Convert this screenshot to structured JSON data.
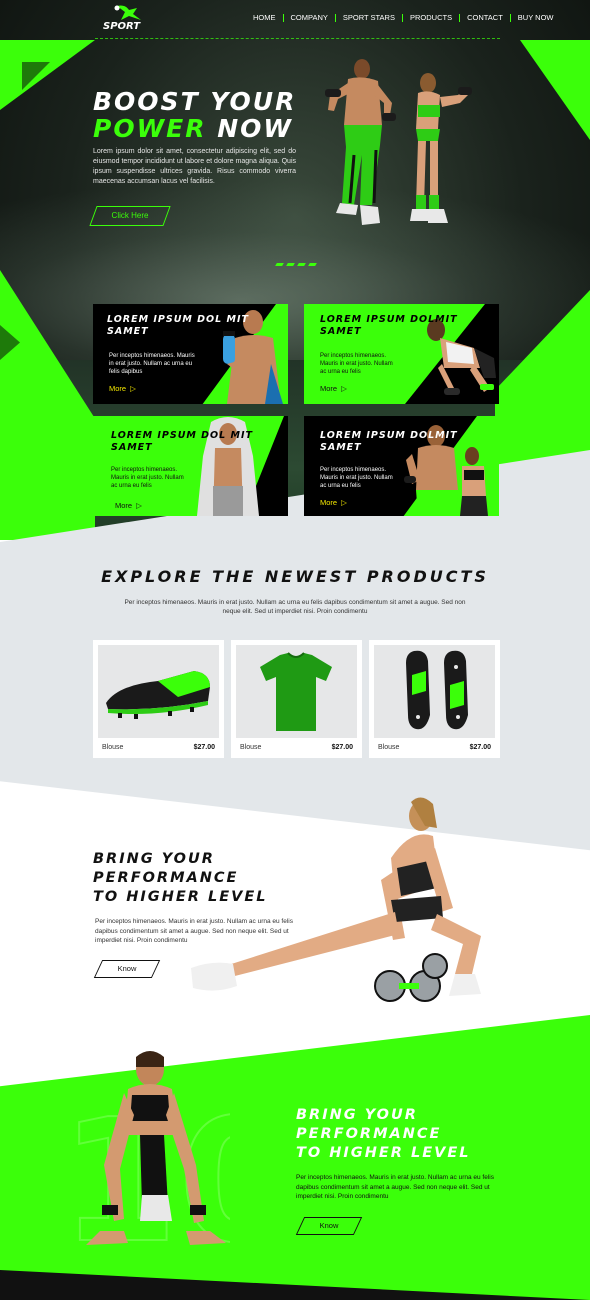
{
  "brand": {
    "logo_text": "SPORT"
  },
  "nav": {
    "items": [
      "HOME",
      "COMPANY",
      "SPORT STARS",
      "PRODUCTS",
      "CONTACT",
      "BUY NOW"
    ]
  },
  "hero": {
    "title_line1": "BOOST YOUR",
    "title_accent": "POWER",
    "title_rest": "NOW",
    "text": "Lorem ipsum dolor sit amet, consectetur adipiscing elit, sed do eiusmod tempor incididunt ut labore et dolore magna aliqua. Quis ipsum suspendisse ultrices gravida. Risus commodo viverra maecenas accumsan lacus vel facilisis.",
    "button": "Click Here"
  },
  "banners": [
    {
      "title": "LOREM IPSUM DOL MIT SAMET",
      "text": "Per inceptos himenaeos. Mauris in erat justo. Nullam ac urna eu felis dapibus",
      "more": "More"
    },
    {
      "title": "LOREM IPSUM DOLMIT SAMET",
      "text": "Per inceptos himenaeos. Mauris in erat justo. Nullam ac urna eu felis",
      "more": "More"
    },
    {
      "title": "LOREM IPSUM DOL MIT SAMET",
      "text": "Per inceptos himenaeos. Mauris in erat justo. Nullam ac urna eu felis",
      "more": "More"
    },
    {
      "title": "LOREM IPSUM DOLMIT SAMET",
      "text": "Per inceptos himenaeos. Mauris in erat justo. Nullam ac urna eu felis",
      "more": "More"
    }
  ],
  "products": {
    "title": "EXPLORE THE NEWEST PRODUCTS",
    "subtitle": "Per inceptos himenaeos. Mauris in erat justo. Nullam ac urna eu felis dapibus condimentum sit amet a augue. Sed non neque elit. Sed ut imperdiet nisi. Proin condimentu",
    "items": [
      {
        "name": "Blouse",
        "price": "$27.00"
      },
      {
        "name": "Blouse",
        "price": "$27.00"
      },
      {
        "name": "Blouse",
        "price": "$27.00"
      }
    ]
  },
  "performance1": {
    "title_lines": [
      "BRING YOUR",
      "PERFORMANCE",
      "TO HIGHER LEVEL"
    ],
    "text": "Per inceptos himenaeos. Mauris in erat justo. Nullam ac urna eu felis dapibus condimentum sit amet a augue. Sed non neque elit. Sed ut imperdiet nisi. Proin condimentu",
    "button": "Know"
  },
  "performance2": {
    "title_lines": [
      "BRING YOUR",
      "PERFORMANCE",
      "TO HIGHER LEVEL"
    ],
    "text": "Per inceptos himenaeos. Mauris in erat justo. Nullam ac urna eu felis dapibus condimentum sit amet a augue. Sed non neque elit. Sed ut imperdiet nisi. Proin condimentu",
    "button": "Know"
  },
  "colors": {
    "accent": "#3bff0a",
    "dark": "#000000",
    "light_bg": "#e3e7ea"
  }
}
